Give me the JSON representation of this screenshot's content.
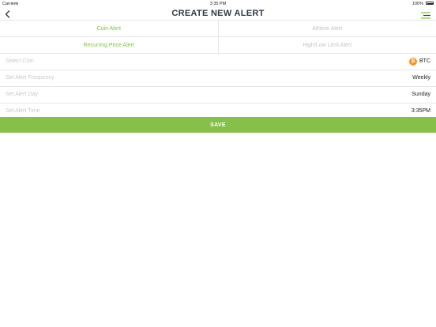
{
  "status_bar": {
    "carrier": "Carrier",
    "time": "3:35 PM",
    "battery": "100%"
  },
  "header": {
    "title": "CREATE NEW ALERT",
    "back_icon": "chevron-left-icon",
    "menu_icon": "menu-icon"
  },
  "tabs": [
    [
      {
        "label": "Coin Alert",
        "active": true
      },
      {
        "label": "Athlete Alert",
        "active": false
      }
    ],
    [
      {
        "label": "Recurring Price Alert",
        "active": true
      },
      {
        "label": "High/Low Limit Alert",
        "active": false
      }
    ]
  ],
  "form": {
    "coin": {
      "label": "Select Coin",
      "value": "BTC",
      "icon": "bitcoin-icon"
    },
    "frequency": {
      "label": "Set Alert Frequency",
      "value": "Weekly"
    },
    "day": {
      "label": "Set Alert Day",
      "value": "Sunday"
    },
    "time": {
      "label": "Set Alert Time",
      "value": "3:35PM"
    }
  },
  "save_label": "SAVE",
  "colors": {
    "accent": "#7fc241",
    "save_bg": "#86c04a",
    "title": "#2f3a45",
    "bitcoin": "#f7931a"
  }
}
